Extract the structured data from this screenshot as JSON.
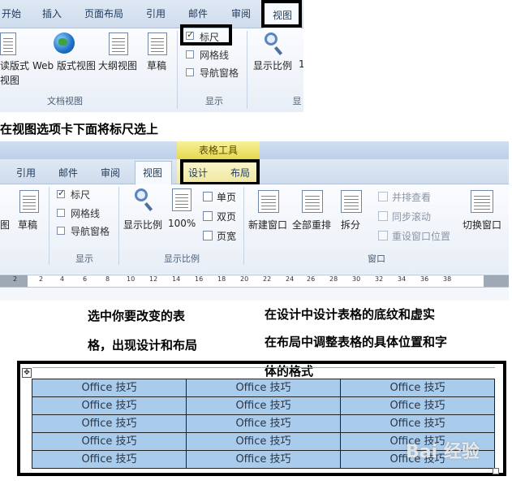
{
  "shot1": {
    "tabs": [
      "开始",
      "插入",
      "页面布局",
      "引用",
      "邮件",
      "审阅",
      "视图"
    ],
    "buttons": [
      "读版式",
      "视图",
      "Web 版式视图",
      "大纲视图",
      "草稿",
      "显示比例",
      "1"
    ],
    "group_labels": [
      "文档视图",
      "显示",
      "显"
    ],
    "checkboxes": [
      {
        "label": "标尺",
        "checked": true
      },
      {
        "label": "网格线",
        "checked": false
      },
      {
        "label": "导航窗格",
        "checked": false
      }
    ]
  },
  "caption1": "在视图选项卡下面将标尺选上",
  "shot2": {
    "context_title": "表格工具",
    "tabs": [
      "引用",
      "邮件",
      "审阅",
      "视图",
      "设计",
      "布局"
    ],
    "checkboxes": [
      {
        "label": "标尺",
        "checked": true
      },
      {
        "label": "网格线",
        "checked": false
      },
      {
        "label": "导航窗格",
        "checked": false
      }
    ],
    "buttons": [
      "图",
      "草稿",
      "显示比例",
      "100%",
      "单页",
      "双页",
      "页宽",
      "新建窗口",
      "全部重排",
      "拆分",
      "并排查看",
      "同步滚动",
      "重设窗口位置",
      "切换窗口"
    ],
    "group_labels": [
      "显示",
      "显示比例",
      "窗口"
    ],
    "ruler_numbers": [
      "2",
      "2",
      "4",
      "6",
      "8",
      "10",
      "12",
      "14",
      "16",
      "18",
      "20",
      "22",
      "24",
      "26",
      "28",
      "30",
      "32",
      "34",
      "36",
      "38"
    ]
  },
  "caption2": "选中你要改变的表",
  "caption3": "格，出现设计和布局",
  "caption4": "在设计中设计表格的底纹和虚实",
  "caption5": "在布局中调整表格的具体位置和字",
  "caption6": "体的格式",
  "table": {
    "rows": [
      [
        "Office 技巧",
        "Office 技巧",
        "Office 技巧"
      ],
      [
        "Office 技巧",
        "Office 技巧",
        "Office 技巧"
      ],
      [
        "Office 技巧",
        "Office 技巧",
        "Office 技巧"
      ],
      [
        "Office 技巧",
        "Office 技巧",
        "Office 技巧"
      ],
      [
        "Office 技巧",
        "Office 技巧",
        "Office 技巧"
      ]
    ]
  },
  "watermark": "Bai 经验",
  "colors": {
    "highlight": "#a9cbec",
    "context_tab": "#e5d84c",
    "ribbon": "#f3f6fb"
  }
}
